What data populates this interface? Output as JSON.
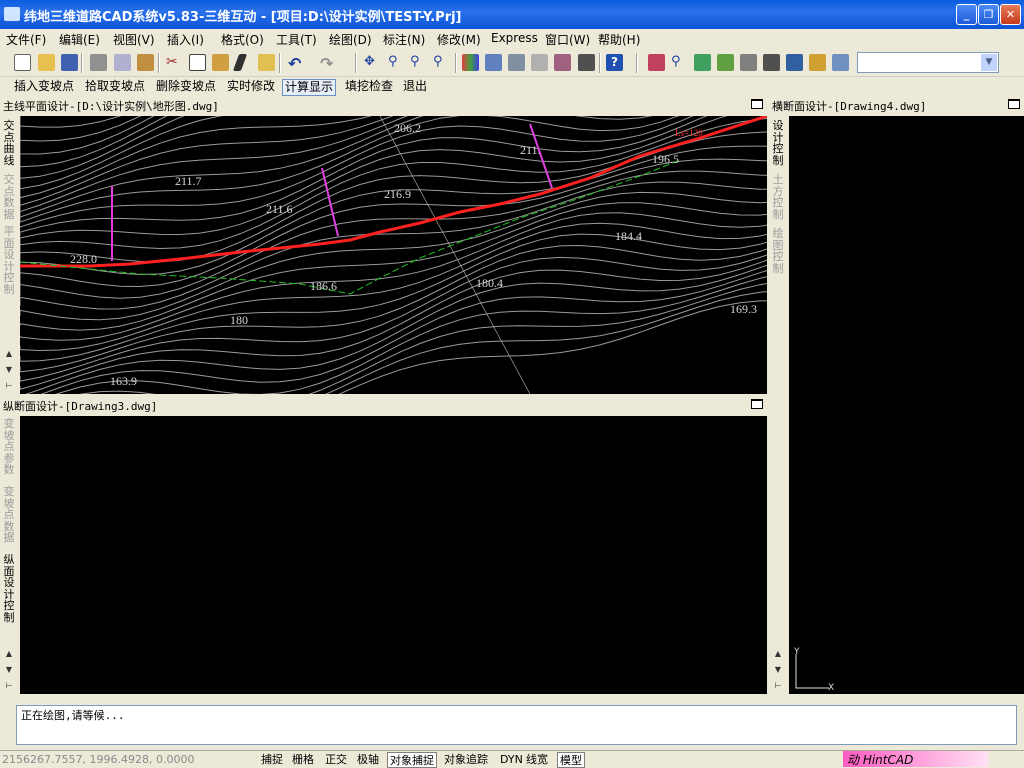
{
  "window": {
    "title": "纬地三维道路CAD系统v5.83-三维互动 - [项目:D:\\设计实例\\TEST-Y.Prj]"
  },
  "menu": [
    "文件(F)",
    "编辑(E)",
    "视图(V)",
    "插入(I)",
    "格式(O)",
    "工具(T)",
    "绘图(D)",
    "标注(N)",
    "修改(M)",
    "Express",
    "窗口(W)",
    "帮助(H)"
  ],
  "toolbar2": [
    "插入变坡点",
    "拾取变坡点",
    "删除变坡点",
    "实时修改",
    "计算显示",
    "填挖检查",
    "退出"
  ],
  "panels": {
    "plan": {
      "title": "主线平面设计-[D:\\设计实例\\地形图.dwg]",
      "tabs": [
        "交点曲线",
        "交点数据",
        "平面设计控制"
      ]
    },
    "profile": {
      "title": "纵断面设计-[Drawing3.dwg]",
      "tabs": [
        "变坡点参数",
        "变坡点数据",
        "纵面设计控制"
      ]
    },
    "cross": {
      "title": "横断面设计-[Drawing4.dwg]",
      "tabs": [
        "设计控制",
        "土方控制",
        "绘图控制"
      ]
    }
  },
  "map_labels": [
    {
      "t": "206.2"
    },
    {
      "t": "211.7"
    },
    {
      "t": "211.6"
    },
    {
      "t": "216.9"
    },
    {
      "t": "211."
    },
    {
      "t": "196.5"
    },
    {
      "t": "184.4"
    },
    {
      "t": "180.4"
    },
    {
      "t": "186.6"
    },
    {
      "t": "180"
    },
    {
      "t": "169.3"
    },
    {
      "t": "163.9"
    },
    {
      "t": "228.0"
    },
    {
      "t": "Ls=120"
    }
  ],
  "command": {
    "text": "正在绘图,请等候..."
  },
  "status": {
    "coords": "2156267.7557, 1996.4928, 0.0000",
    "buttons": [
      "捕捉",
      "栅格",
      "正交",
      "极轴",
      "对象捕捉",
      "对象追踪",
      "DYN",
      "线宽",
      "模型"
    ],
    "hint": "动 HintCAD"
  },
  "axes": {
    "y": "Y",
    "x": "X"
  },
  "colors": {
    "road": "#ff2020",
    "profile_line": "#20c020",
    "station_marks": "#e040e0",
    "contours": "#9a9a9a"
  }
}
